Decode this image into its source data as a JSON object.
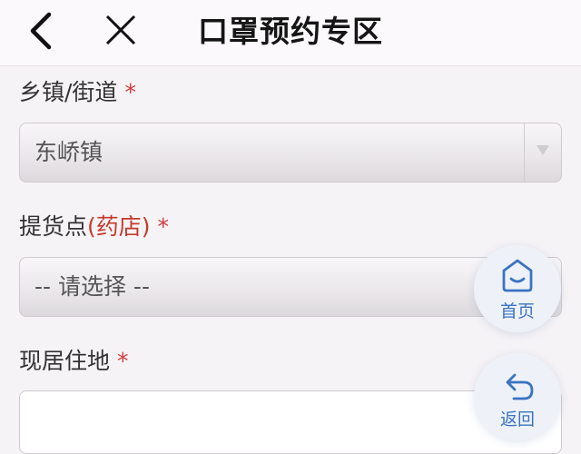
{
  "header": {
    "title": "口罩预约专区",
    "back_icon": "chevron-left-icon",
    "close_icon": "close-icon"
  },
  "form": {
    "street": {
      "label": "乡镇/街道",
      "required_mark": "*",
      "value": "东峤镇"
    },
    "pickup": {
      "label": "提货点",
      "label_highlight": "(药店)",
      "required_mark": "*",
      "value": "-- 请选择 --"
    },
    "residence": {
      "label": "现居住地",
      "required_mark": "*",
      "value": ""
    }
  },
  "floating": {
    "home_label": "首页",
    "home_icon": "home-icon",
    "back_label": "返回",
    "back_icon": "return-arrow-icon"
  },
  "colors": {
    "required": "#d33a3a",
    "highlight": "#c43a2a",
    "accent_blue": "#3a73c2"
  }
}
